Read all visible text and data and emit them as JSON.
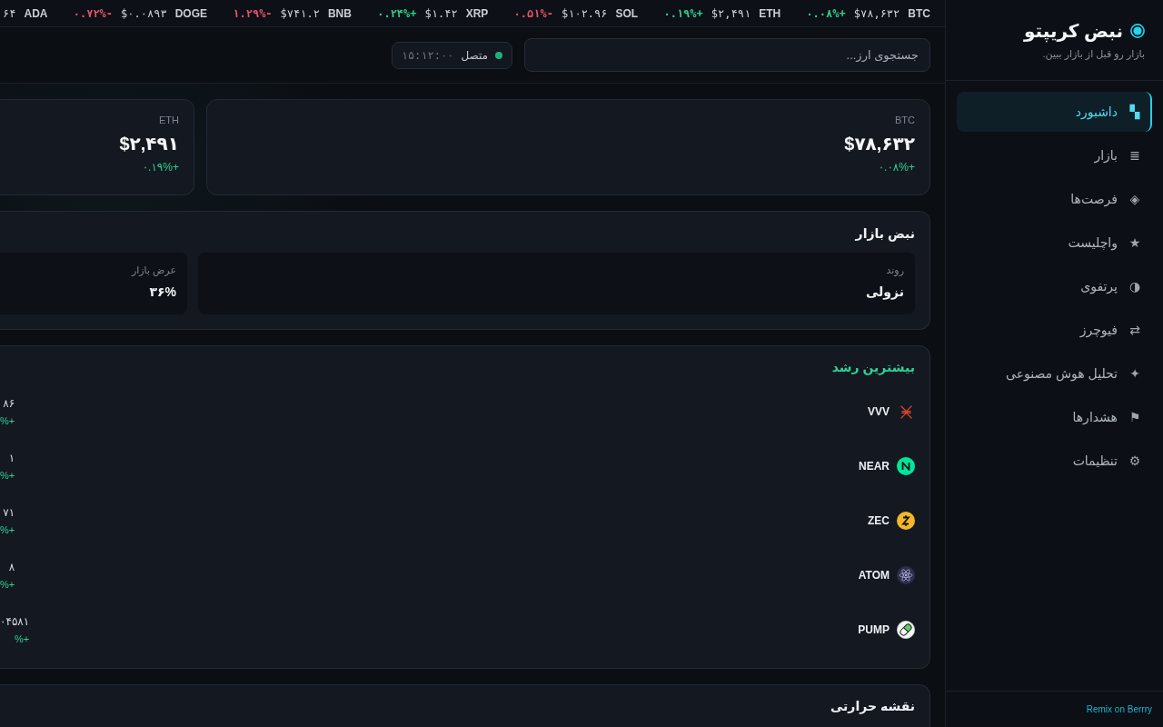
{
  "sidebar": {
    "brand": {
      "title": "نبض کریپتو",
      "tagline": "بازار رو قبل از بازار ببین."
    },
    "nav": [
      {
        "icon": "▚",
        "label": "داشبورد",
        "selected": true
      },
      {
        "icon": "≣",
        "label": "بازار",
        "selected": false
      },
      {
        "icon": "◈",
        "label": "فرصت‌ها",
        "selected": false
      },
      {
        "icon": "★",
        "label": "واچلیست",
        "selected": false
      },
      {
        "icon": "◑",
        "label": "پرتفوی",
        "selected": false
      },
      {
        "icon": "⇄",
        "label": "فیوچرز",
        "selected": false
      },
      {
        "icon": "✦",
        "label": "تحلیل هوش مصنوعی",
        "selected": false
      },
      {
        "icon": "⚑",
        "label": "هشدارها",
        "selected": false
      },
      {
        "icon": "⚙",
        "label": "تنظیمات",
        "selected": false
      }
    ],
    "footer_link": "Remix on Berrry"
  },
  "ticker": [
    {
      "symbol": "BTC",
      "price": "$۷۸,۶۳۲",
      "change": "+۰.۰۸%",
      "color": "#2fd192"
    },
    {
      "symbol": "ETH",
      "price": "$۲,۴۹۱",
      "change": "+۰.۱۹%",
      "color": "#2fd192"
    },
    {
      "symbol": "SOL",
      "price": "$۱۰۲.۹۶",
      "change": "-۰.۵۱%",
      "color": "#e5566d"
    },
    {
      "symbol": "XRP",
      "price": "$۱.۴۲",
      "change": "+۰.۲۴%",
      "color": "#2fd192"
    },
    {
      "symbol": "BNB",
      "price": "$۷۴۱.۲",
      "change": "-۱.۲۹%",
      "color": "#e5566d"
    },
    {
      "symbol": "DOGE",
      "price": "$۰.۰۸۹۳",
      "change": "-۰.۷۲%",
      "color": "#e5566d"
    },
    {
      "symbol": "ADA",
      "price": "۶۴"
    }
  ],
  "header": {
    "search": {
      "placeholder": "جستجوی ارز..."
    },
    "status": {
      "connected": true,
      "label": "متصل",
      "time": "۱۵:۱۲:۰۰"
    }
  },
  "price_cards": [
    {
      "symbol": "BTC",
      "price": "$۷۸,۶۳۲",
      "change": "+۰.۰۸%"
    },
    {
      "symbol": "ETH",
      "price": "$۲,۴۹۱",
      "change": "+۰.۱۹%"
    }
  ],
  "market_pulse": {
    "title": "نبض بازار",
    "tiles": [
      {
        "label": "روند",
        "value": "نزولی"
      },
      {
        "label": "عرض بازار",
        "value": "۳۶%"
      }
    ]
  },
  "top_gainers": {
    "title": "بیشترین رشد",
    "rows": [
      {
        "symbol": "VVV",
        "price": "۸۶",
        "change": "+%"
      },
      {
        "symbol": "NEAR",
        "price": "۱",
        "change": "+%"
      },
      {
        "symbol": "ZEC",
        "price": "۷۱",
        "change": "+%"
      },
      {
        "symbol": "ATOM",
        "price": "۸",
        "change": "+%"
      },
      {
        "symbol": "PUMP",
        "price": "۰۴۵۸۱",
        "change": "+%"
      }
    ]
  },
  "heatmap": {
    "title": "نقشه حرارتی"
  }
}
